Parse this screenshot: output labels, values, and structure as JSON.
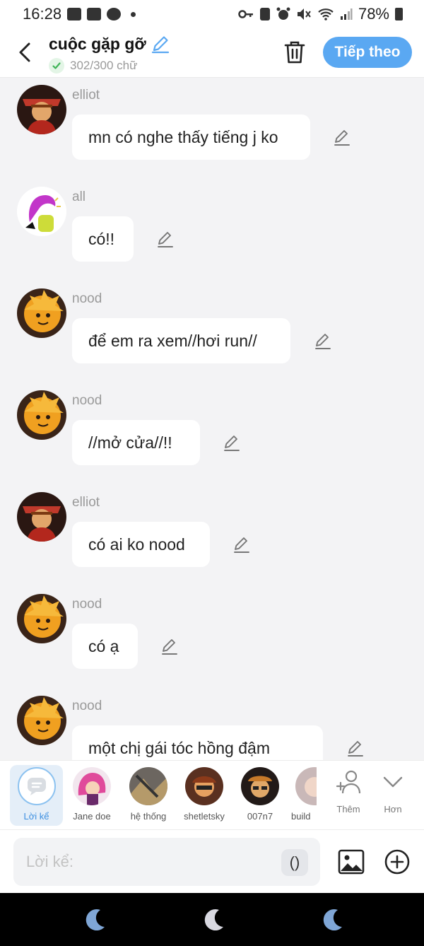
{
  "status_bar": {
    "time": "16:28",
    "battery": "78%"
  },
  "header": {
    "title": "cuộc gặp gỡ",
    "word_count": "302/300 chữ",
    "next_label": "Tiếp theo"
  },
  "messages": [
    {
      "user": "elliot",
      "text": "mn có nghe thấy tiếng j ko",
      "avatar": "elliot"
    },
    {
      "user": "all",
      "text": "có!!",
      "avatar": "all"
    },
    {
      "user": "nood",
      "text": "để em ra xem//hơi run//",
      "avatar": "nood"
    },
    {
      "user": "nood",
      "text": "//mở cửa//!!",
      "avatar": "nood"
    },
    {
      "user": "elliot",
      "text": "có ai ko nood",
      "avatar": "elliot"
    },
    {
      "user": "nood",
      "text": "có ạ",
      "avatar": "nood"
    },
    {
      "user": "nood",
      "text": "một chị gái tóc hồng đậm",
      "avatar": "nood"
    }
  ],
  "characters": [
    {
      "label": "Lời kể"
    },
    {
      "label": "Jane doe"
    },
    {
      "label": "hệ thống"
    },
    {
      "label": "shetletsky"
    },
    {
      "label": "007n7"
    },
    {
      "label": "build"
    }
  ],
  "tools": {
    "add_label": "Thêm",
    "more_label": "Hơn"
  },
  "input": {
    "placeholder": "Lời kể:",
    "paren_label": "()"
  },
  "colors": {
    "accent": "#5aa8f2",
    "bubble": "#ffffff",
    "chat_bg": "#f3f3f5"
  }
}
